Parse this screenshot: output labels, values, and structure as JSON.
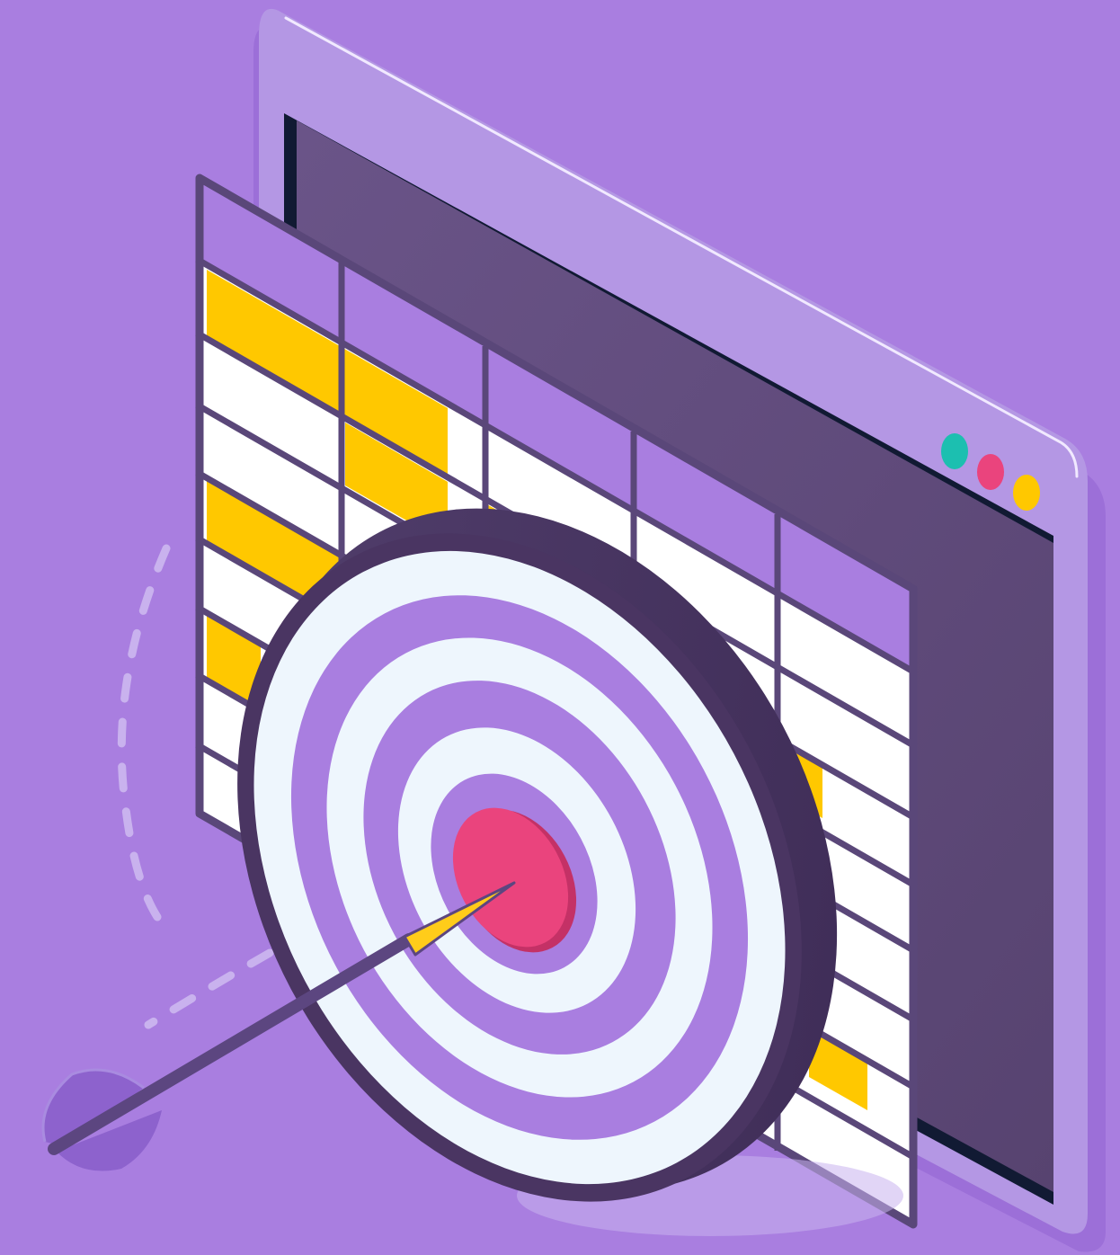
{
  "scene": {
    "subject": "target-with-arrow-over-spreadsheet-window",
    "icons": [
      "browser-window-icon",
      "spreadsheet-icon",
      "bullseye-target-icon",
      "arrow-icon"
    ]
  },
  "colors": {
    "background": "#a97ee0",
    "window_frame": "#b497e4",
    "window_frame_shadow": "#8f66cf",
    "window_screen": "#5f4a7c",
    "window_screen_edge": "#111a33",
    "grid_line": "#5a4779",
    "cell_white": "#ffffff",
    "cell_yellow": "#ffc800",
    "cell_purple": "#a97ee0",
    "target_rim": "#4a3562",
    "target_light": "#eef6fd",
    "target_ring": "#a97ee0",
    "bullseye": "#ea447d",
    "bullseye_shade": "#c43166",
    "arrow_shaft": "#5c4680",
    "arrow_tip": "#ffcc1a",
    "arrow_fletching": "#8d62cd",
    "dashed_trail": "#c9b2ee",
    "dot_teal": "#1cbfb0",
    "dot_pink": "#ea447d",
    "dot_yellow": "#ffc800"
  }
}
